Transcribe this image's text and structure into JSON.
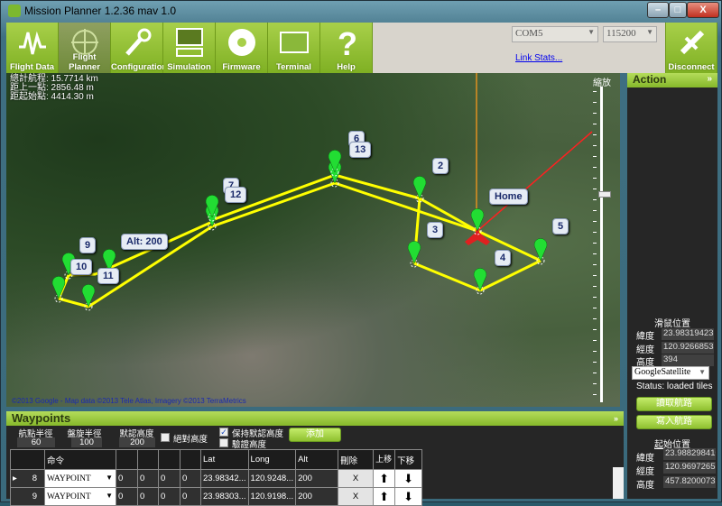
{
  "window": {
    "title": "Mission Planner 1.2.36 mav 1.0"
  },
  "toolbar": {
    "items": [
      {
        "label": "Flight Data",
        "icon": "pulse-icon"
      },
      {
        "label": "Flight Planner",
        "icon": "compass-icon",
        "selected": true
      },
      {
        "label": "Configuration",
        "icon": "wrench-icon"
      },
      {
        "label": "Simulation",
        "icon": "monitor-plane-icon"
      },
      {
        "label": "Firmware",
        "icon": "disc-icon"
      },
      {
        "label": "Terminal",
        "icon": "terminal-icon"
      },
      {
        "label": "Help",
        "icon": "question-icon"
      }
    ],
    "com_port": "COM5",
    "baud_rate": "115200",
    "link_stats": "Link Stats...",
    "disconnect": "Disconnect"
  },
  "map": {
    "stats": [
      "總計航程: 15.7714 km",
      "距上一點: 2856.48 m",
      "距起始點: 4414.30 m"
    ],
    "labels": {
      "wp2": "2",
      "wp3": "3",
      "wp4": "4",
      "wp5": "5",
      "wp6": "6",
      "wp7": "7",
      "wp9": "9",
      "wp10": "10",
      "wp11": "11",
      "wp12": "12",
      "wp13": "13",
      "home": "Home",
      "alt": "Alt: 200"
    },
    "attribution": "©2013 Google - Map data ©2013 Tele Atlas, Imagery ©2013 TerraMetrics",
    "zoom_label": "縮放",
    "zoom_level": 0.67,
    "path_color": "#ffff00"
  },
  "action": {
    "title": "Action",
    "mouse_pos_title": "滑鼠位置",
    "lat_label": "緯度",
    "lng_label": "經度",
    "alt_label": "高度",
    "mouse_lat": "23.983194237",
    "mouse_lng": "120.92668533",
    "mouse_alt": "394",
    "map_type": "GoogleSatellite",
    "status": "Status: loaded tiles",
    "read_wp": "讀取航路",
    "write_wp": "寫入航路",
    "home_title": "起始位置",
    "home_lat": "23.9882984100",
    "home_lng": "120.969726560",
    "home_alt": "457.82000732"
  },
  "waypoints": {
    "title": "Waypoints",
    "wp_radius_label": "航點半徑",
    "wp_radius": "60",
    "loiter_radius_label": "盤旋半徑",
    "loiter_radius": "100",
    "default_alt_label": "默認高度",
    "default_alt": "200",
    "absolute_alt": "絕對高度",
    "absolute_alt_checked": false,
    "hold_default_alt": "保持默認高度",
    "hold_default_alt_checked": true,
    "verify_height": "驗證高度",
    "verify_height_checked": false,
    "add": "添加",
    "columns": [
      "",
      "命令",
      "",
      "",
      "",
      "",
      "Lat",
      "Long",
      "Alt",
      "刪除",
      "上移",
      "下移"
    ],
    "rows": [
      {
        "num": "8",
        "cmd": "WAYPOINT",
        "p1": "0",
        "p2": "0",
        "p3": "0",
        "p4": "0",
        "lat": "23.98342...",
        "lng": "120.9248...",
        "alt": "200",
        "del": "X"
      },
      {
        "num": "9",
        "cmd": "WAYPOINT",
        "p1": "0",
        "p2": "0",
        "p3": "0",
        "p4": "0",
        "lat": "23.98303...",
        "lng": "120.9198...",
        "alt": "200",
        "del": "X"
      }
    ]
  }
}
